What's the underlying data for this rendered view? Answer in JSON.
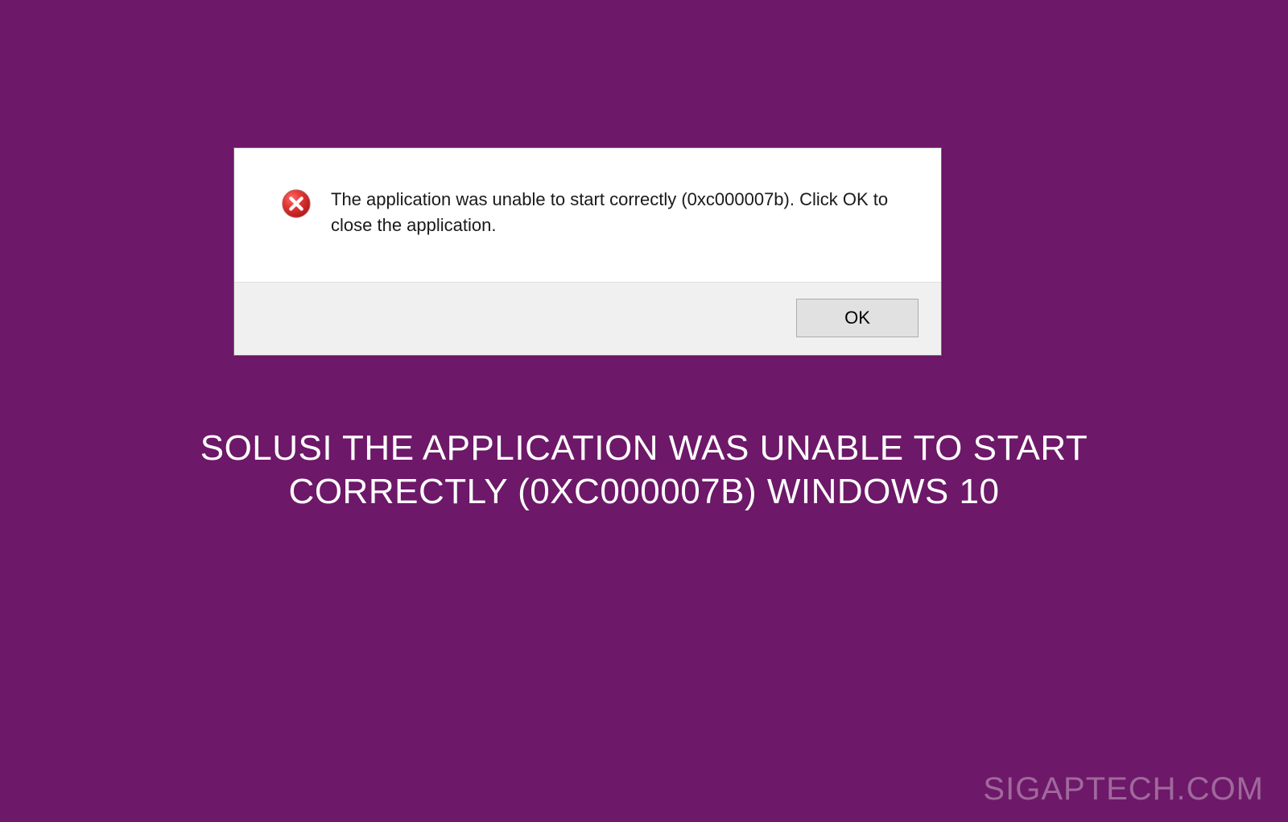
{
  "dialog": {
    "message": "The application was unable to start correctly (0xc000007b). Click OK to close the application.",
    "ok_label": "OK"
  },
  "headline": "SOLUSI THE APPLICATION WAS UNABLE TO START CORRECTLY (0XC000007B) WINDOWS 10",
  "watermark": "SIGAPTECH.COM"
}
